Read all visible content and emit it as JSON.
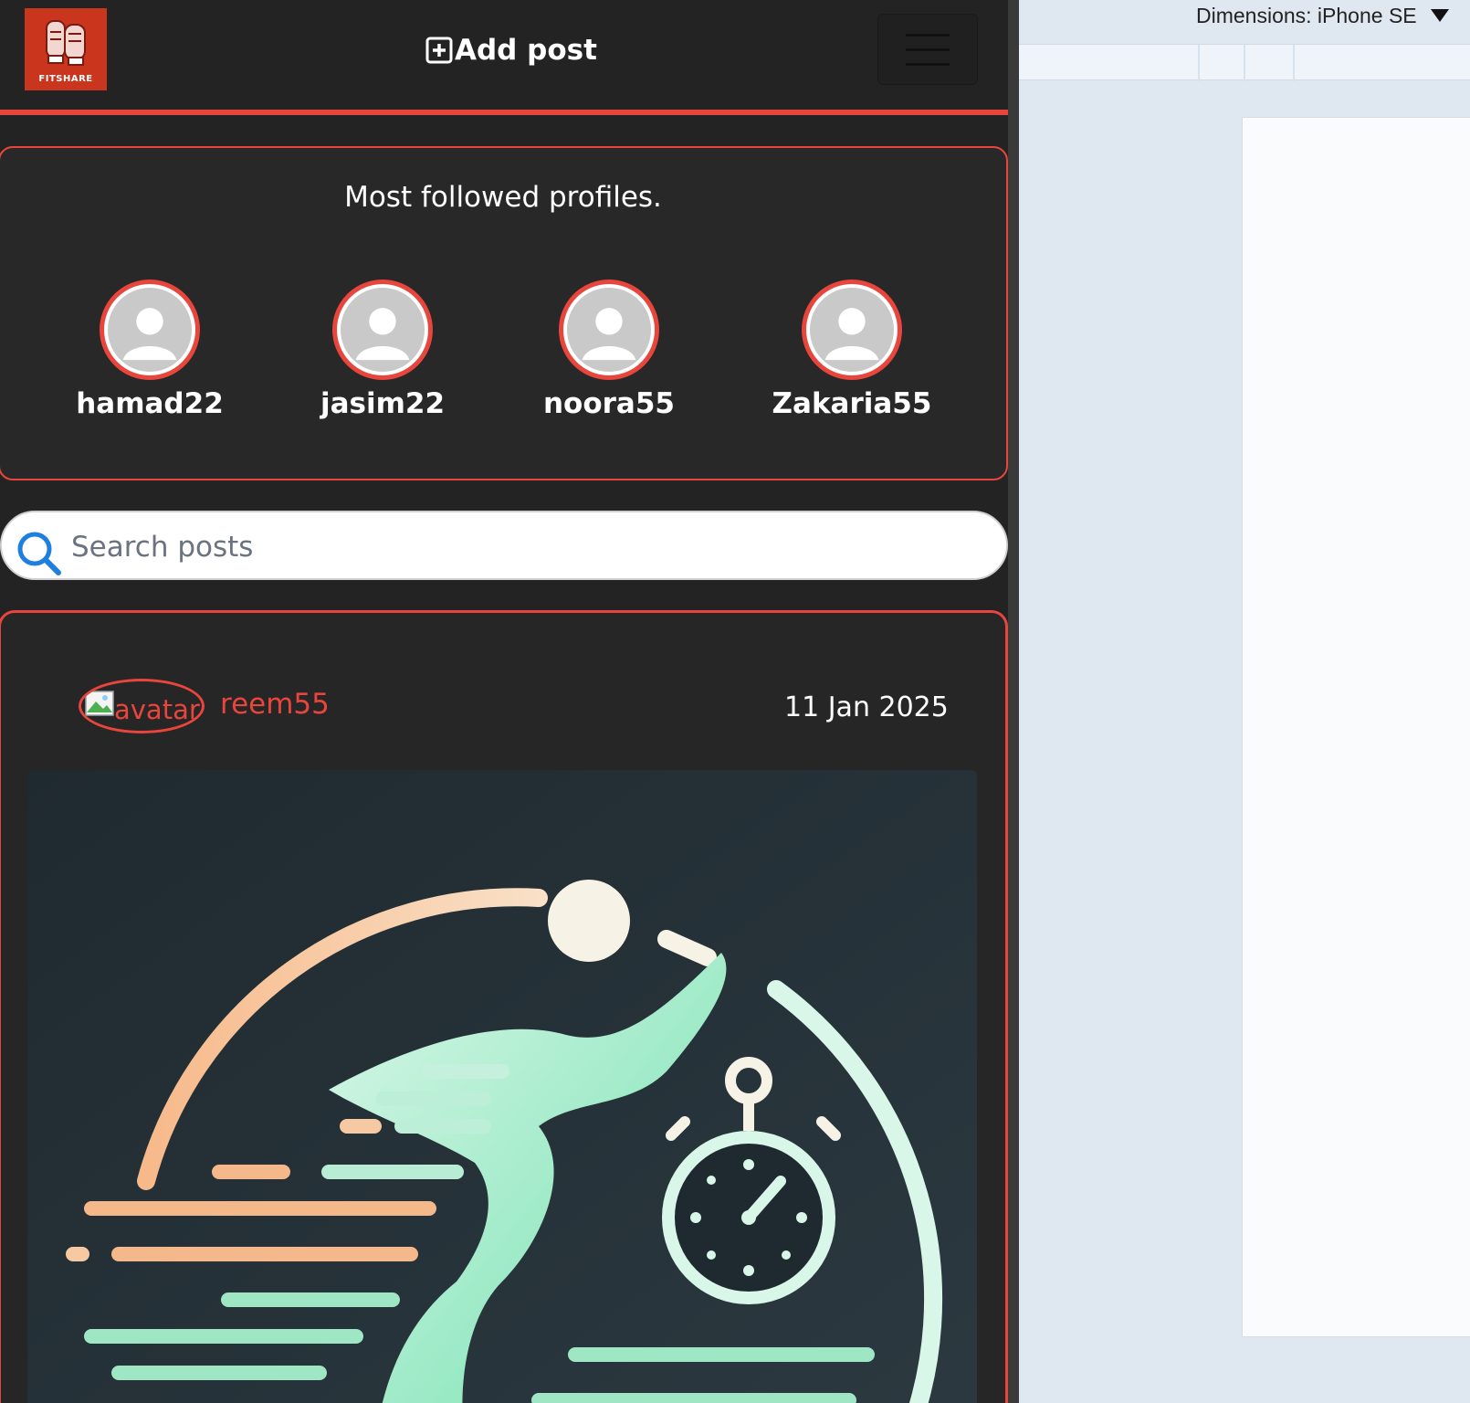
{
  "app": {
    "logo_text": "FITSHARE",
    "add_post_label": "Add post",
    "accent_color": "#e8453c",
    "background_color": "#232323"
  },
  "most_followed": {
    "title": "Most followed profiles.",
    "profiles": [
      {
        "username": "hamad22"
      },
      {
        "username": "jasim22"
      },
      {
        "username": "noora55"
      },
      {
        "username": "Zakaria55"
      }
    ]
  },
  "search": {
    "placeholder": "Search posts",
    "value": ""
  },
  "post": {
    "avatar_alt": "avatar",
    "author": "reem55",
    "date": "11 Jan 2025"
  },
  "devtools": {
    "dimensions_label": "Dimensions: iPhone SE"
  },
  "icons": [
    "plus-square-icon",
    "hamburger-menu-icon",
    "default-user-icon",
    "search-icon",
    "broken-image-icon",
    "caret-down-icon"
  ]
}
